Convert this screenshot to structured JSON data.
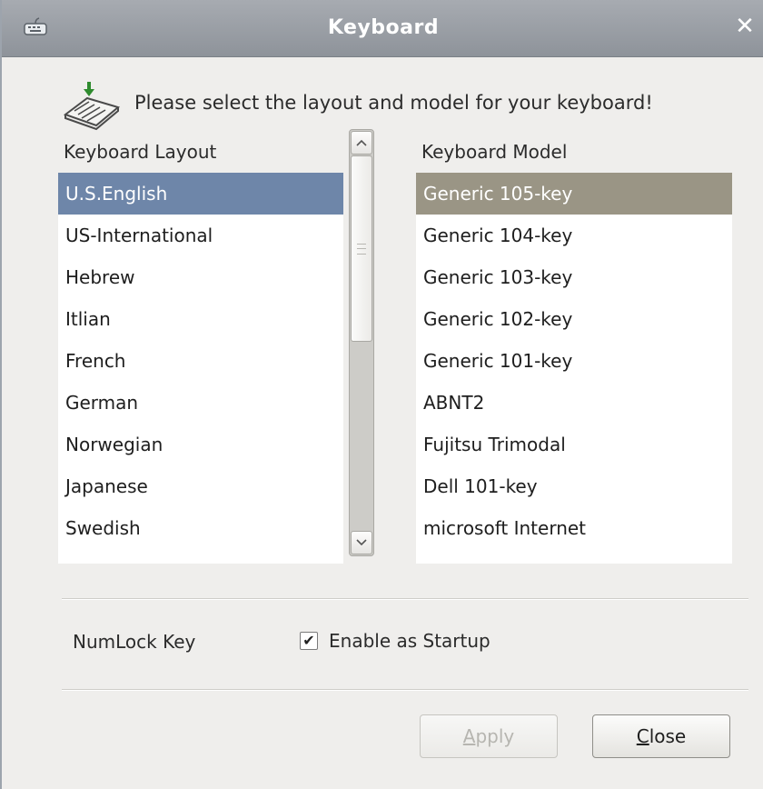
{
  "window": {
    "title": "Keyboard",
    "icon": "keyboard-icon",
    "close_glyph": "✕"
  },
  "intro": {
    "icon": "keyboard-download-icon",
    "text": "Please select the layout and model for your keyboard!"
  },
  "layout": {
    "header": "Keyboard Layout",
    "items": [
      "U.S.English",
      "US-International",
      "Hebrew",
      "Itlian",
      "French",
      "German",
      "Norwegian",
      "Japanese",
      "Swedish"
    ],
    "selected": "U.S.English"
  },
  "model": {
    "header": "Keyboard Model",
    "items": [
      "Generic 105-key",
      "Generic 104-key",
      "Generic 103-key",
      "Generic 102-key",
      "Generic 101-key",
      "ABNT2",
      "Fujitsu Trimodal",
      "Dell 101-key",
      "microsoft Internet"
    ],
    "selected": "Generic 105-key"
  },
  "numlock": {
    "label": "NumLock Key",
    "checkbox_label": "Enable as Startup",
    "checked": true,
    "check_glyph": "✔"
  },
  "buttons": {
    "apply": {
      "mnemonic": "A",
      "rest": "pply",
      "enabled": false
    },
    "close": {
      "mnemonic": "C",
      "rest": "lose",
      "enabled": true
    }
  },
  "colors": {
    "title_bar": "#9a9fa6",
    "layout_selection": "#6e86a9",
    "model_selection": "#9a9585"
  }
}
